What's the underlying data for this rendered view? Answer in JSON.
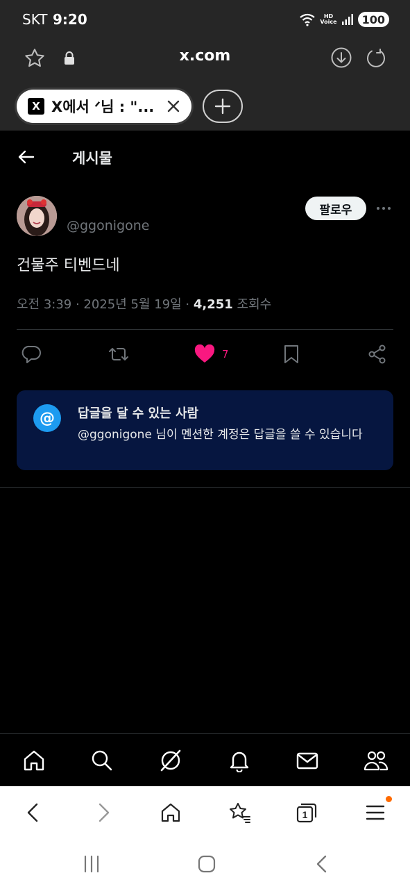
{
  "status_bar": {
    "carrier": "SKT",
    "time": "9:20",
    "battery": "100",
    "network": "5",
    "hd_label": "HD",
    "voice_label": "Voice"
  },
  "browser": {
    "url": "x.com",
    "tab_title": "X에서 ᐟ님 : \"...",
    "tab_favicon": "X"
  },
  "page": {
    "title": "게시물"
  },
  "post": {
    "handle": "@ggonigone",
    "follow_label": "팔로우",
    "text": "건물주 티벤드네",
    "meta_time": "오전 3:39 · 2025년 5월 19일 · ",
    "views": "4,251",
    "views_label": " 조회수",
    "like_count": "7",
    "like_color": "#f91880"
  },
  "reply_info": {
    "icon": "@",
    "title": "답글을 달 수 있는 사람",
    "description": "@ggonigone 님이 멘션한 계정은 답글을 쓸 수 있습니다"
  },
  "x_nav": {
    "items": [
      "home-icon",
      "search-icon",
      "grok-icon",
      "notifications-icon",
      "messages-icon",
      "communities-icon"
    ]
  },
  "browser_toolbar": {
    "tab_count": "1",
    "items": [
      "back-icon",
      "forward-icon",
      "home-icon",
      "bookmarks-icon",
      "tabs-icon",
      "menu-icon"
    ]
  },
  "colors": {
    "accent": "#1d9bf0",
    "like": "#f91880",
    "reply_box_bg": "#061640",
    "chrome_bg": "#262626"
  }
}
